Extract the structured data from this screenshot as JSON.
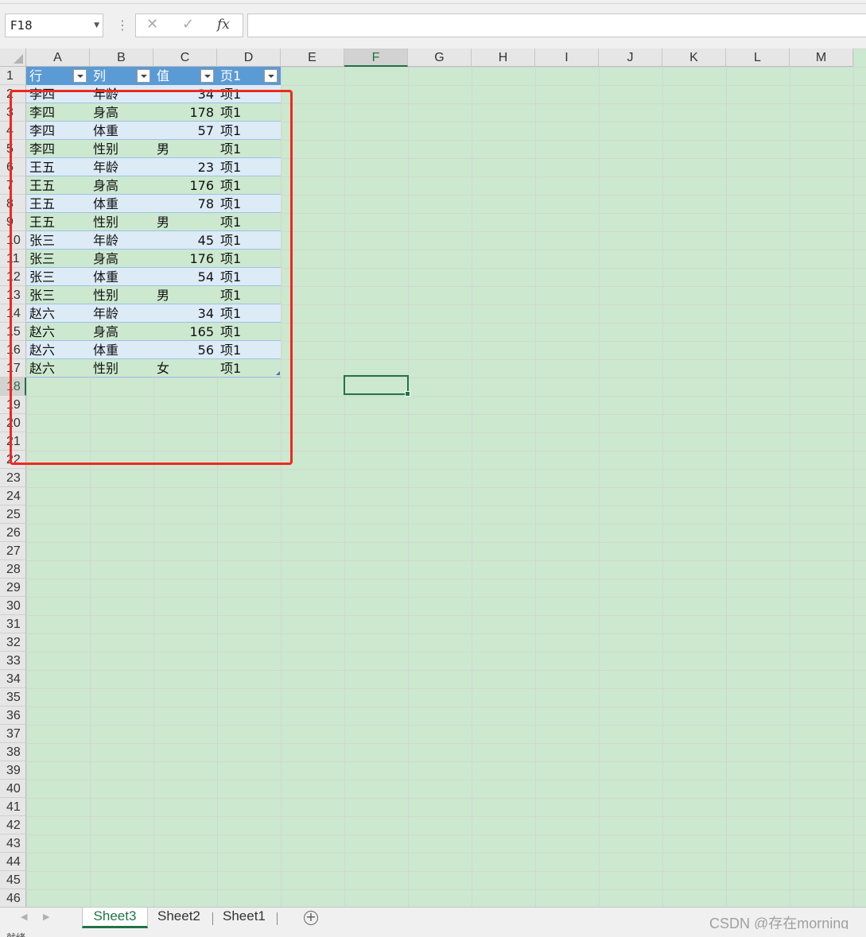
{
  "formula_bar": {
    "name_box": "F18",
    "cancel_icon": "✕",
    "enter_icon": "✓",
    "fx_label": "fx",
    "formula": ""
  },
  "columns": [
    "A",
    "B",
    "C",
    "D",
    "E",
    "F",
    "G",
    "H",
    "I",
    "J",
    "K",
    "L",
    "M"
  ],
  "selected_column": "F",
  "rows": [
    1,
    2,
    3,
    4,
    5,
    6,
    7,
    8,
    9,
    10,
    11,
    12,
    13,
    14,
    15,
    16,
    17,
    18,
    19,
    20,
    21,
    22,
    23,
    24,
    25,
    26,
    27,
    28,
    29,
    30,
    31,
    32,
    33,
    34,
    35,
    36,
    37,
    38,
    39,
    40,
    41,
    42,
    43,
    44,
    45,
    46
  ],
  "selected_row": 18,
  "table": {
    "headers": [
      "行",
      "列",
      "值",
      "页1"
    ],
    "rows": [
      [
        "李四",
        "年龄",
        "34",
        "项1"
      ],
      [
        "李四",
        "身高",
        "178",
        "项1"
      ],
      [
        "李四",
        "体重",
        "57",
        "项1"
      ],
      [
        "李四",
        "性别",
        "男",
        "项1"
      ],
      [
        "王五",
        "年龄",
        "23",
        "项1"
      ],
      [
        "王五",
        "身高",
        "176",
        "项1"
      ],
      [
        "王五",
        "体重",
        "78",
        "项1"
      ],
      [
        "王五",
        "性别",
        "男",
        "项1"
      ],
      [
        "张三",
        "年龄",
        "45",
        "项1"
      ],
      [
        "张三",
        "身高",
        "176",
        "项1"
      ],
      [
        "张三",
        "体重",
        "54",
        "项1"
      ],
      [
        "张三",
        "性别",
        "男",
        "项1"
      ],
      [
        "赵六",
        "年龄",
        "34",
        "项1"
      ],
      [
        "赵六",
        "身高",
        "165",
        "项1"
      ],
      [
        "赵六",
        "体重",
        "56",
        "项1"
      ],
      [
        "赵六",
        "性别",
        "女",
        "项1"
      ]
    ]
  },
  "sheets": {
    "tabs": [
      "Sheet3",
      "Sheet2",
      "Sheet1"
    ],
    "active": "Sheet3",
    "add_label": "+"
  },
  "watermark": "CSDN @存在morning",
  "status_bar": "就绪"
}
